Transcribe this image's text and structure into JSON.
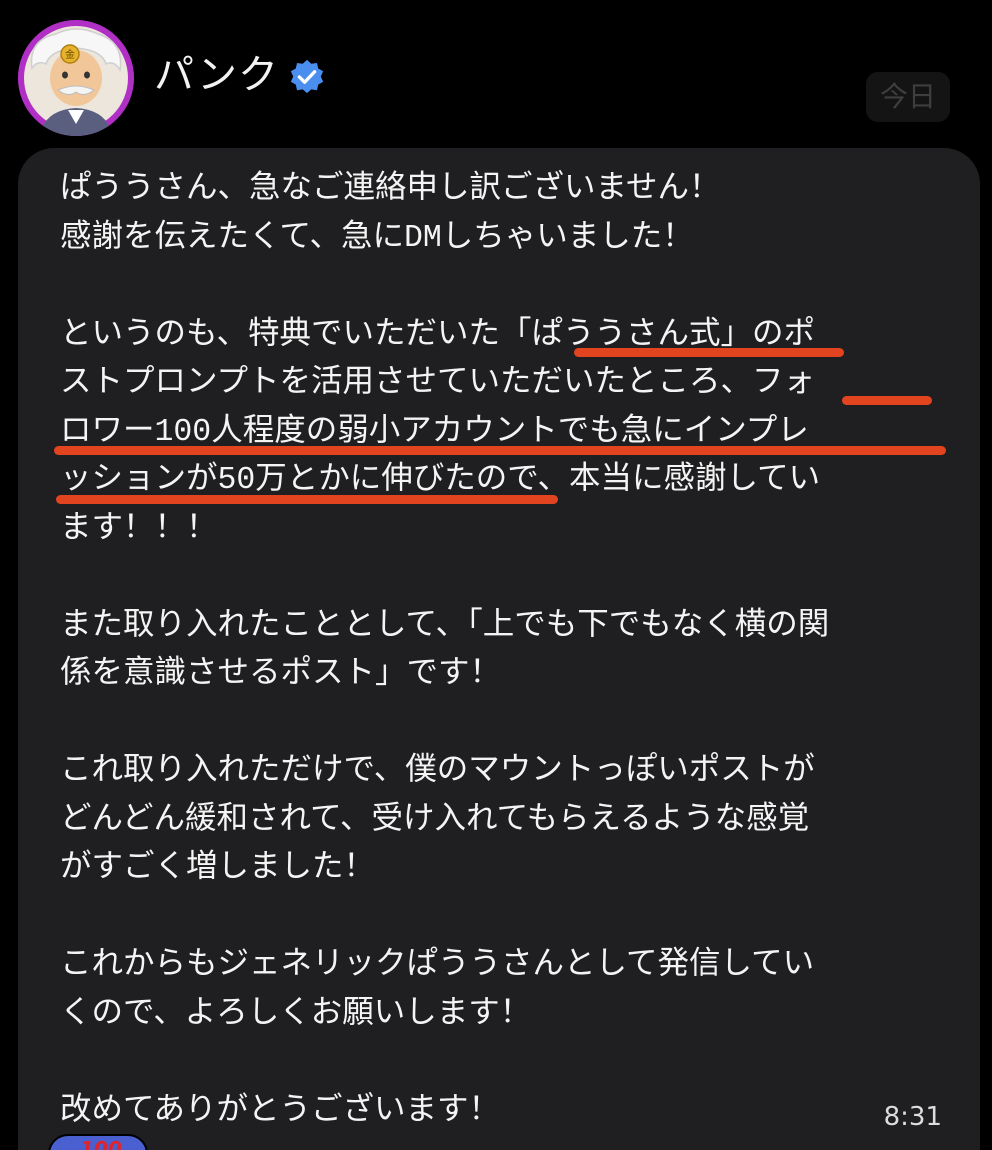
{
  "header": {
    "sender_name": "パンク",
    "date_label": "今日"
  },
  "message": {
    "lines": [
      "ぱううさん、急なご連絡申し訳ございません！",
      "感謝を伝えたくて、急にDMしちゃいました！",
      "",
      "というのも、特典でいただいた「ぱううさん式」のポ",
      "ストプロンプトを活用させていただいたところ、フォ",
      "ロワー100人程度の弱小アカウントでも急にインプレ",
      "ッションが50万とかに伸びたので、本当に感謝してい",
      "ます！！！",
      "",
      "また取り入れたこととして、「上でも下でもなく横の関",
      "係を意識させるポスト」です！",
      "",
      "これ取り入れただけで、僕のマウントっぽいポストが",
      "どんどん緩和されて、受け入れてもらえるような感覚",
      "がすごく増しました！",
      "",
      "これからもジェネリックぱううさんとして発信してい",
      "くので、よろしくお願いします！",
      "",
      "改めてありがとうございます！"
    ],
    "time": "8:31"
  },
  "reaction": {
    "emoji_name": "hundred-points-emoji"
  },
  "colors": {
    "background": "#000000",
    "bubble": "#1f1f21",
    "text": "#f4f4f4",
    "highlight_underline": "#e24420",
    "verified": "#4a8ef0",
    "avatar_ring": "#b02fc4"
  }
}
